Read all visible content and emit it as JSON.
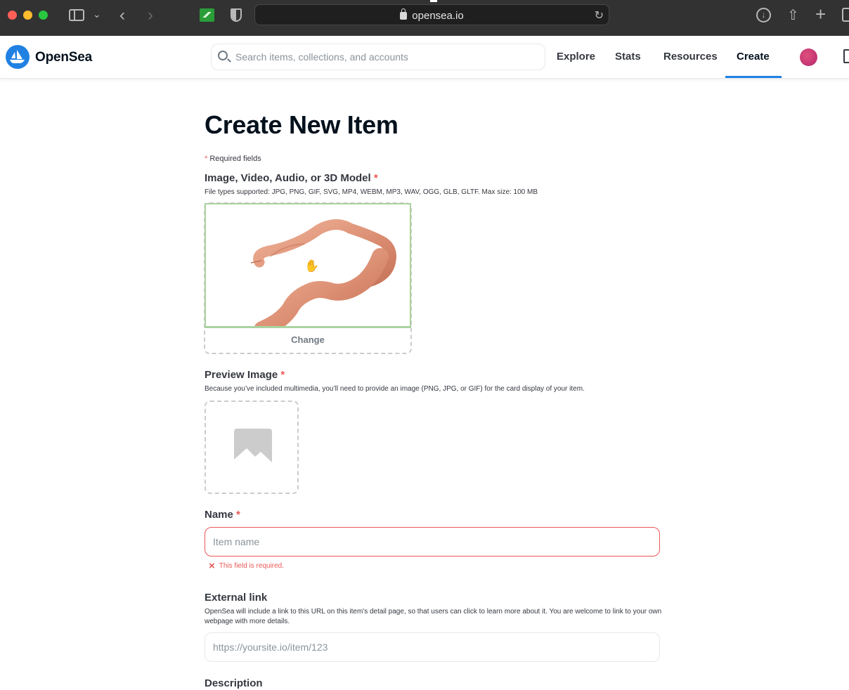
{
  "browser": {
    "url": "opensea.io"
  },
  "header": {
    "brand": "OpenSea",
    "search_placeholder": "Search items, collections, and accounts",
    "nav": {
      "explore": "Explore",
      "stats": "Stats",
      "resources": "Resources",
      "create": "Create"
    },
    "active_nav": "create",
    "accent_color": "#2081e2"
  },
  "form": {
    "title": "Create New Item",
    "required_marker": "*",
    "required_note": "Required fields",
    "media": {
      "label": "Image, Video, Audio, or 3D Model",
      "hint": "File types supported: JPG, PNG, GIF, SVG, MP4, WEBM, MP3, WAV, OGG, GLB, GLTF. Max size: 100 MB",
      "change_label": "Change"
    },
    "preview_image": {
      "label": "Preview Image",
      "hint": "Because you’ve included multimedia, you’ll need to provide an image (PNG, JPG, or GIF) for the card display of your item."
    },
    "name": {
      "label": "Name",
      "placeholder": "Item name",
      "value": "",
      "error": "This field is required."
    },
    "external_link": {
      "label": "External link",
      "hint": "OpenSea will include a link to this URL on this item's detail page, so that users can click to learn more about it. You are welcome to link to your own webpage with more details.",
      "placeholder": "https://yoursite.io/item/123",
      "value": ""
    },
    "description": {
      "label": "Description"
    }
  },
  "colors": {
    "error": "#eb5757",
    "upload_border_active": "#a9d3a0",
    "dashed_border": "#cccccc"
  }
}
